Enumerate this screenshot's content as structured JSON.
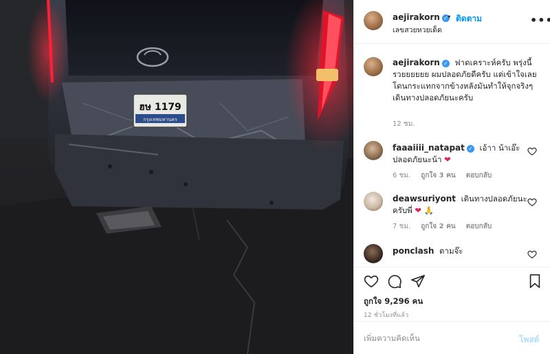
{
  "post": {
    "username": "aejirakorn",
    "verified_glyph": "✓",
    "dot": "•",
    "follow_label": "ติดตาม",
    "subtitle": "เลขสวยหวยเด็ด",
    "more_glyph": "•••",
    "image_alt": "Damaged rear bumper of a dark van at night with license plate",
    "plate": {
      "number": "ฮษ 1179",
      "province": "กรุงเทพมหานคร"
    }
  },
  "caption": {
    "username": "aejirakorn",
    "text": "ฟาดเคราะห์ครับ พรุ่งนี้รวยยยยยย ผมปลอดภัยดีครับ แต่เข้าใจเลย โดนกระแทกจากข้างหลังมันทำให้จุกจริงๆ เดินทางปลอดภัยนะครับ",
    "time": "12 ชม."
  },
  "comments": [
    {
      "username": "faaaiiii_natapat",
      "verified": true,
      "text": "เอ้าา น้าเอ๊ะ ปลอดภัยนะน้า",
      "emoji": "❤",
      "time": "6 ชม.",
      "likes": "ถูกใจ 3 คน",
      "reply": "ตอบกลับ",
      "avatar_color": "#8a6a4c"
    },
    {
      "username": "deawsuriyont",
      "verified": false,
      "text": "เดินทางปลอดภัยนะครับพี่",
      "emoji": "❤ 🙏",
      "time": "7 ชม.",
      "likes": "ถูกใจ 2 คน",
      "reply": "ตอบกลับ",
      "avatar_color": "#c9b8a4"
    },
    {
      "username": "ponclash",
      "verified": false,
      "text": "ตามจ๊ะ",
      "emoji": "",
      "avatar_color": "#3a2a22"
    }
  ],
  "actions": {
    "likes": "ถูกใจ 9,296 คน",
    "ago": "12 ชั่วโมงที่แล้ว",
    "icons": [
      "heart-icon",
      "comment-icon",
      "share-icon",
      "bookmark-icon"
    ]
  },
  "composer": {
    "placeholder": "เพิ่มความคิดเห็น",
    "post_label": "โพสต์"
  },
  "colors": {
    "link": "#0095f6",
    "muted": "#8e8e8e",
    "text": "#262626",
    "post_disabled": "#b2dffc",
    "heart_red": "#e0245e"
  }
}
